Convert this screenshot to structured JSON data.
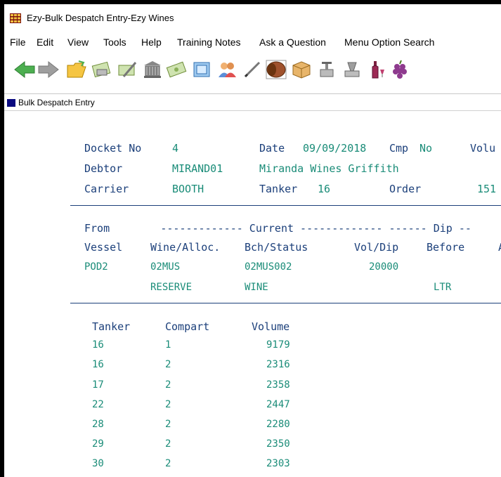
{
  "window": {
    "title": "Ezy-Bulk Despatch Entry-Ezy Wines"
  },
  "menu": [
    "File",
    "Edit",
    "View",
    "Tools",
    "Help",
    "Training Notes",
    "Ask a Question",
    "Menu Option Search"
  ],
  "toolbar": {
    "icons": [
      "back-arrow-icon",
      "forward-arrow-icon",
      "folder-open-icon",
      "cash-icon",
      "edit-cash-icon",
      "bank-icon",
      "money-icon",
      "document-icon",
      "users-icon",
      "pen-icon",
      "barrel-icon",
      "box-icon",
      "press-icon",
      "filter-icon",
      "bottle-icon",
      "grapes-icon"
    ]
  },
  "form_tab": {
    "title": "Bulk Despatch Entry"
  },
  "header": {
    "docket_no_label": "Docket No",
    "docket_no": "4",
    "date_label": "Date",
    "date": "09/09/2018",
    "cmp_label": "Cmp",
    "cmp": "No",
    "volume_label": "Volu",
    "debtor_label": "Debtor",
    "debtor_code": "MIRAND01",
    "debtor_name": "Miranda Wines Griffith",
    "carrier_label": "Carrier",
    "carrier": "BOOTH",
    "tanker_label": "Tanker",
    "tanker": "16",
    "order_label": "Order",
    "order": "151"
  },
  "source": {
    "line1": "From        ------------- Current ------------- ------ Dip --",
    "headers": {
      "vessel": "Vessel",
      "wine": "Wine/Alloc.",
      "batch": "Bch/Status",
      "voldip": "Vol/Dip",
      "before": "Before",
      "after": "A"
    },
    "vessel": "POD2",
    "wine": "02MUS",
    "batch": "02MUS002",
    "voldip": "20000",
    "alloc": "RESERVE",
    "status": "WINE",
    "unit": "LTR"
  },
  "compartments": {
    "headers": {
      "tanker": "Tanker",
      "compart": "Compart",
      "volume": "Volume"
    },
    "rows": [
      {
        "tanker": "16",
        "compart": "1",
        "volume": "9179"
      },
      {
        "tanker": "16",
        "compart": "2",
        "volume": "2316"
      },
      {
        "tanker": "17",
        "compart": "2",
        "volume": "2358"
      },
      {
        "tanker": "22",
        "compart": "2",
        "volume": "2447"
      },
      {
        "tanker": "28",
        "compart": "2",
        "volume": "2280"
      },
      {
        "tanker": "29",
        "compart": "2",
        "volume": "2350"
      },
      {
        "tanker": "30",
        "compart": "2",
        "volume": "2303"
      }
    ]
  },
  "colors": {
    "label": "#1b3f7a",
    "value": "#1a8c78",
    "accent": "#0a0a80"
  }
}
